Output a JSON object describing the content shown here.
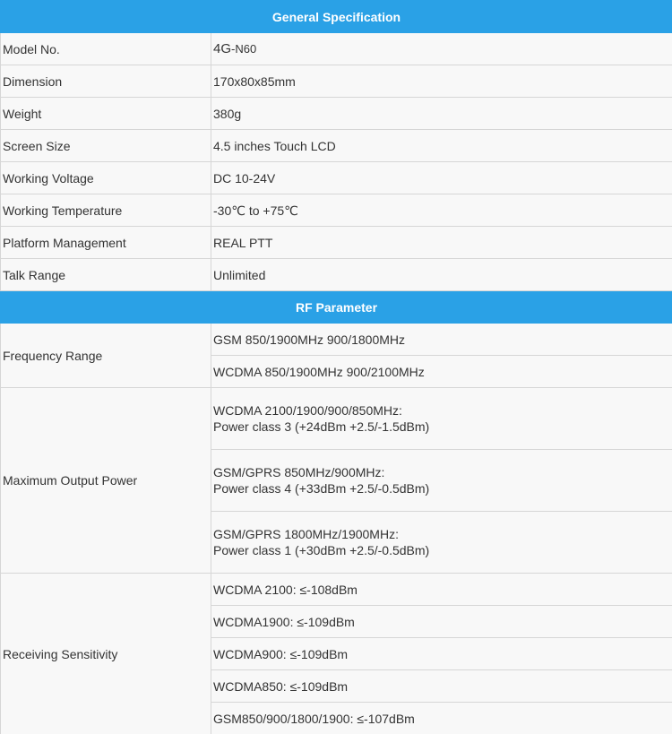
{
  "general": {
    "header": "General Specification",
    "rows": [
      {
        "label": "Model No.",
        "value_prefix": "4G",
        "value_suffix": "-N60"
      },
      {
        "label": "Dimension",
        "value": "170x80x85mm"
      },
      {
        "label": "Weight",
        "value": "380g"
      },
      {
        "label": "Screen Size",
        "value": "4.5 inches Touch LCD"
      },
      {
        "label": "Working Voltage",
        "value": "DC 10-24V"
      },
      {
        "label": "Working Temperature",
        "value": "-30℃ to +75℃"
      },
      {
        "label": "Platform Management",
        "value": "REAL PTT"
      },
      {
        "label": "Talk Range",
        "value": "Unlimited"
      }
    ]
  },
  "rf": {
    "header": "RF Parameter",
    "frequency_range": {
      "label": "Frequency Range",
      "values": [
        "GSM 850/1900MHz 900/1800MHz",
        "WCDMA 850/1900MHz 900/2100MHz"
      ]
    },
    "max_output_power": {
      "label": "Maximum Output Power",
      "values": [
        {
          "line1": "WCDMA 2100/1900/900/850MHz:",
          "line2": "Power class 3 (+24dBm +2.5/-1.5dBm)"
        },
        {
          "line1": "GSM/GPRS 850MHz/900MHz:",
          "line2": "Power class 4 (+33dBm +2.5/-0.5dBm)"
        },
        {
          "line1": "GSM/GPRS 1800MHz/1900MHz:",
          "line2": "Power class 1 (+30dBm +2.5/-0.5dBm)"
        }
      ]
    },
    "receiving_sensitivity": {
      "label": "Receiving Sensitivity",
      "values": [
        "WCDMA 2100: ≤-108dBm",
        "WCDMA1900: ≤-109dBm",
        "WCDMA900: ≤-109dBm",
        "WCDMA850: ≤-109dBm",
        "GSM850/900/1800/1900: ≤-107dBm"
      ]
    }
  }
}
